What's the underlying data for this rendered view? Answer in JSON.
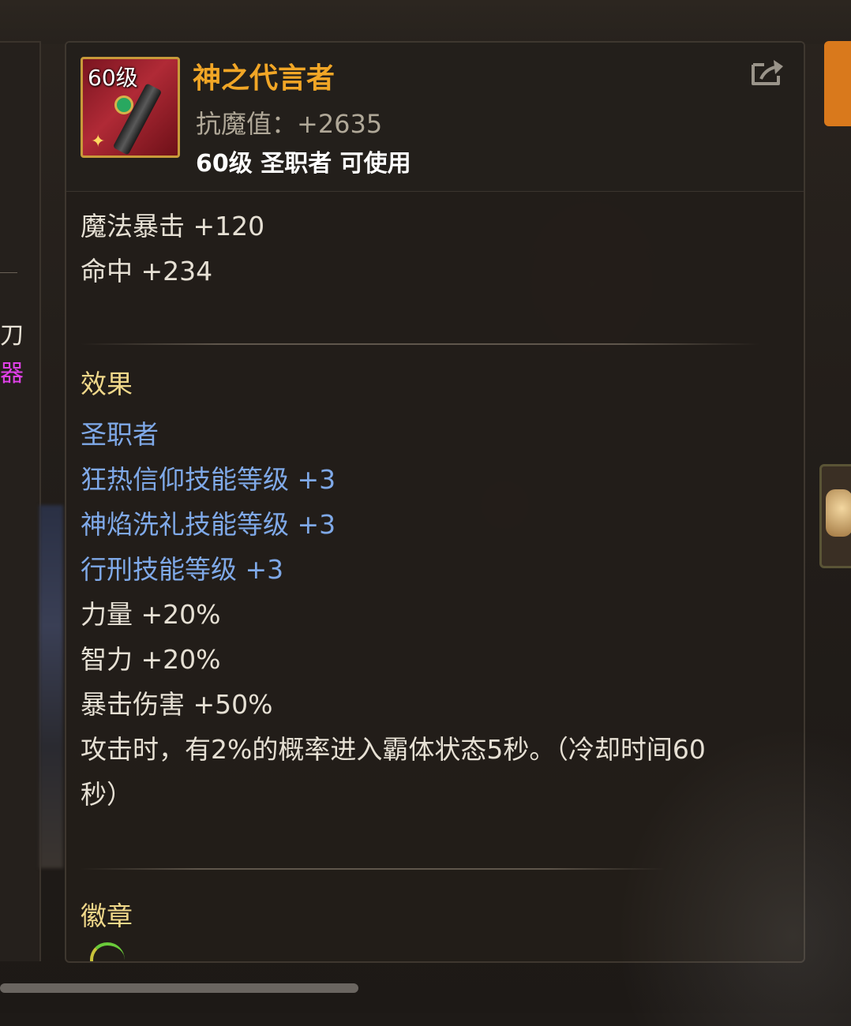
{
  "item": {
    "level_badge": "60级",
    "name": "神之代言者",
    "stat": "抗魔值：+2635",
    "requirement": "60级 圣职者 可使用",
    "share_icon": "share-export-icon"
  },
  "attributes": [
    "魔法暴击 +120",
    "命中 +234"
  ],
  "effects": {
    "heading": "效果",
    "class_name": "圣职者",
    "skill_bonuses": [
      "狂热信仰技能等级 +3",
      "神焰洗礼技能等级 +3",
      "行刑技能等级 +3"
    ],
    "stat_bonuses": [
      "力量 +20%",
      "智力 +20%",
      "暴击伤害 +50%"
    ],
    "proc_text_1": "攻击时，有2%的概率进入霸体状态5秒。（冷却时间60",
    "proc_text_2": "秒）"
  },
  "emblem": {
    "heading": "徽章"
  },
  "left_panel": {
    "char_1": "刀",
    "char_2": "器"
  },
  "colors": {
    "title": "#f1a626",
    "effect_blue": "#7fa9e8",
    "heading_yellow": "#f0d88a",
    "icon_border": "#c89a3a"
  }
}
